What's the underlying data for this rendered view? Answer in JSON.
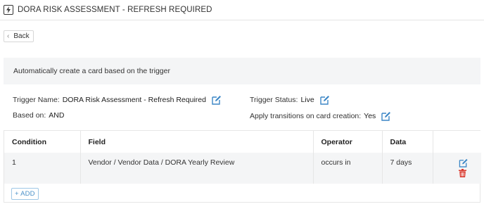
{
  "header": {
    "title": "DORA RISK ASSESSMENT - REFRESH REQUIRED",
    "icon": "lightning-bolt-icon"
  },
  "back_button": {
    "label": "Back"
  },
  "panel": {
    "text": "Automatically create a card based on the trigger"
  },
  "trigger": {
    "name_label": "Trigger Name:",
    "name_value": "DORA Risk Assessment - Refresh Required",
    "based_on_label": "Based on:",
    "based_on_value": "AND",
    "status_label": "Trigger Status:",
    "status_value": "Live",
    "transitions_label": "Apply transitions on card creation:",
    "transitions_value": "Yes"
  },
  "table": {
    "headers": [
      "Condition",
      "Field",
      "Operator",
      "Data",
      ""
    ],
    "rows": [
      {
        "condition": "1",
        "field": "Vendor / Vendor Data / DORA Yearly Review",
        "operator": "occurs in",
        "data": "7 days"
      }
    ],
    "add_label": "+ ADD"
  },
  "colors": {
    "accent": "#3b86c6",
    "danger": "#d9362b",
    "panel_bg": "#f4f5f6"
  }
}
